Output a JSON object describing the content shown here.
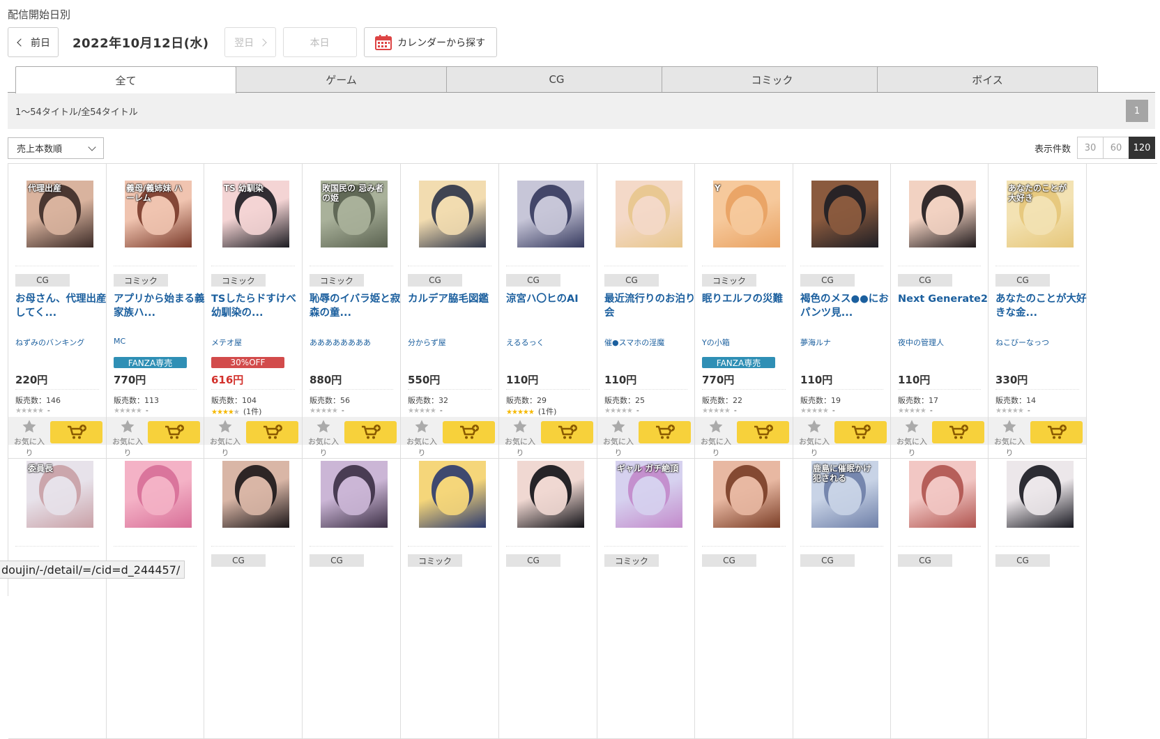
{
  "heading": "配信開始日別",
  "nav": {
    "prev": "前日",
    "date": "2022年10月12日(水)",
    "next": "翌日",
    "today": "本日",
    "calendar": "カレンダーから探す"
  },
  "tabs": [
    {
      "label": "全て",
      "active": true
    },
    {
      "label": "ゲーム",
      "active": false
    },
    {
      "label": "CG",
      "active": false
    },
    {
      "label": "コミック",
      "active": false
    },
    {
      "label": "ボイス",
      "active": false
    }
  ],
  "count_text": "1〜54タイトル/全54タイトル",
  "page": "1",
  "sort": "売上本数順",
  "perpage": {
    "label": "表示件数",
    "options": [
      "30",
      "60",
      "120"
    ],
    "selected": "120"
  },
  "fav_label": "お気に入り",
  "items": [
    {
      "category": "CG",
      "title": "お母さん、代理出産してく...",
      "maker": "ねずみのバンキング",
      "badge": "",
      "price": "220円",
      "sales": "販売数：146",
      "rating": 0,
      "reviews": "-",
      "thumb_text": "代理出産",
      "colors": [
        "#d9b39e",
        "#3b2a26"
      ]
    },
    {
      "category": "コミック",
      "title": "アプリから始まる義家族ハ...",
      "maker": "MC",
      "badge": "FANZA専売",
      "price": "770円",
      "sales": "販売数：113",
      "rating": 0,
      "reviews": "-",
      "thumb_text": "義母/義姉妹 ハーレム",
      "colors": [
        "#f0c4b0",
        "#7a3a2a"
      ]
    },
    {
      "category": "コミック",
      "title": "TSしたらドすけべ幼馴染の...",
      "maker": "メテオ屋",
      "badge": "30%OFF",
      "price": "616円",
      "sales": "販売数：104",
      "rating": 4,
      "reviews": "(1件)",
      "thumb_text": "TS 幼馴染",
      "colors": [
        "#f4d4d4",
        "#1c1c22"
      ]
    },
    {
      "category": "コミック",
      "title": "恥辱のイバラ姫と寂森の童...",
      "maker": "ああああああああ",
      "badge": "",
      "price": "880円",
      "sales": "販売数：56",
      "rating": 0,
      "reviews": "-",
      "thumb_text": "敗国民の 忌み者の姫",
      "colors": [
        "#a9b19a",
        "#5a6250"
      ]
    },
    {
      "category": "CG",
      "title": "カルデア脇毛図鑑",
      "maker": "分からず屋",
      "badge": "",
      "price": "550円",
      "sales": "販売数：32",
      "rating": 0,
      "reviews": "-",
      "thumb_text": "",
      "colors": [
        "#f2dcb0",
        "#2d3448"
      ]
    },
    {
      "category": "CG",
      "title": "涼宮ハ〇ヒのAI",
      "maker": "えるるっく",
      "badge": "",
      "price": "110円",
      "sales": "販売数：29",
      "rating": 5,
      "reviews": "(1件)",
      "thumb_text": "",
      "colors": [
        "#c7c6d8",
        "#35395e"
      ]
    },
    {
      "category": "CG",
      "title": "最近流行りのお泊り会",
      "maker": "催●スマホの淫魔",
      "badge": "",
      "price": "110円",
      "sales": "販売数：25",
      "rating": 0,
      "reviews": "-",
      "thumb_text": "",
      "colors": [
        "#f4d9c8",
        "#e8c78d"
      ]
    },
    {
      "category": "コミック",
      "title": "眠りエルフの災難",
      "maker": "Yの小箱",
      "badge": "FANZA専売",
      "price": "770円",
      "sales": "販売数：22",
      "rating": 0,
      "reviews": "-",
      "thumb_text": "Y",
      "colors": [
        "#f6c99c",
        "#e9a262"
      ]
    },
    {
      "category": "CG",
      "title": "褐色のメス●●におパンツ見...",
      "maker": "夢海ルナ",
      "badge": "",
      "price": "110円",
      "sales": "販売数：19",
      "rating": 0,
      "reviews": "-",
      "thumb_text": "",
      "colors": [
        "#8a5a3e",
        "#1e1e24"
      ]
    },
    {
      "category": "CG",
      "title": "Next Generate2",
      "maker": "夜中の管理人",
      "badge": "",
      "price": "110円",
      "sales": "販売数：17",
      "rating": 0,
      "reviews": "-",
      "thumb_text": "",
      "colors": [
        "#f2d2c2",
        "#201a1c"
      ]
    },
    {
      "category": "CG",
      "title": "あなたのことが大好きな金...",
      "maker": "ねこびーなっつ",
      "badge": "",
      "price": "330円",
      "sales": "販売数：14",
      "rating": 0,
      "reviews": "-",
      "thumb_text": "あなたのことが大好き",
      "colors": [
        "#f3e2b3",
        "#e6c77a"
      ]
    }
  ],
  "items_row2": [
    {
      "category": "",
      "thumb_text": "委員長",
      "colors": [
        "#e7e2ea",
        "#c9a0a6"
      ]
    },
    {
      "category": "",
      "thumb_text": "",
      "colors": [
        "#f4b2c6",
        "#d86f98"
      ]
    },
    {
      "category": "CG",
      "thumb_text": "",
      "colors": [
        "#d9b6a6",
        "#1b1618"
      ]
    },
    {
      "category": "CG",
      "thumb_text": "",
      "colors": [
        "#cbb6d6",
        "#3c2f45"
      ]
    },
    {
      "category": "コミック",
      "thumb_text": "",
      "colors": [
        "#f5d67a",
        "#2c3a6e"
      ]
    },
    {
      "category": "CG",
      "thumb_text": "",
      "colors": [
        "#f0d8d2",
        "#111116"
      ]
    },
    {
      "category": "コミック",
      "thumb_text": "ギャル ガチ絶頂",
      "colors": [
        "#d6d1ef",
        "#c38acb"
      ]
    },
    {
      "category": "CG",
      "thumb_text": "",
      "colors": [
        "#e8b8a2",
        "#7a3d26"
      ]
    },
    {
      "category": "CG",
      "thumb_text": "鹿島に催眠かけ 犯される",
      "colors": [
        "#c8d3e6",
        "#6e7fa8"
      ]
    },
    {
      "category": "CG",
      "thumb_text": "",
      "colors": [
        "#f2c7c4",
        "#b0544f"
      ]
    },
    {
      "category": "CG",
      "thumb_text": "",
      "colors": [
        "#ece7ea",
        "#181820"
      ]
    }
  ],
  "status_url": "doujin/-/detail/=/cid=d_244457/"
}
